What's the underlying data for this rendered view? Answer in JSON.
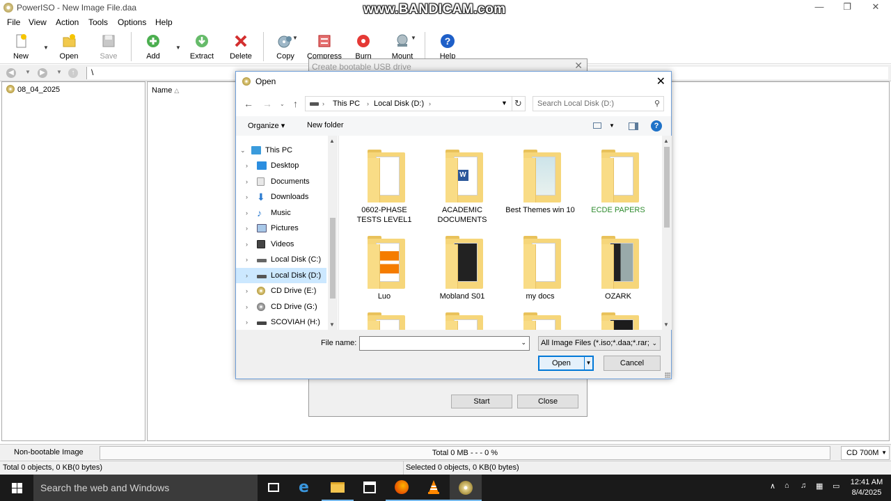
{
  "app": {
    "title": "PowerISO - New Image File.daa",
    "watermark": "www.BANDICAM.com",
    "window_buttons": {
      "minimize": "—",
      "maximize": "❐",
      "close": "✕"
    }
  },
  "menu": [
    "File",
    "View",
    "Action",
    "Tools",
    "Options",
    "Help"
  ],
  "toolbar": {
    "new": "New",
    "open": "Open",
    "save": "Save",
    "add": "Add",
    "extract": "Extract",
    "delete": "Delete",
    "copy": "Copy",
    "compress": "Compress",
    "burn": "Burn",
    "mount": "Mount",
    "help": "Help"
  },
  "address": {
    "path": "\\"
  },
  "tree": {
    "root": "08_04_2025"
  },
  "list": {
    "column_name": "Name"
  },
  "usb_dialog": {
    "title": "Create bootable USB drive",
    "start": "Start",
    "close": "Close"
  },
  "open_dialog": {
    "title": "Open",
    "breadcrumb": [
      "This PC",
      "Local Disk (D:)"
    ],
    "search_placeholder": "Search Local Disk (D:)",
    "organize": "Organize ▾",
    "new_folder": "New folder",
    "nav_items": [
      {
        "label": "This PC",
        "icon": "this-pc-icon"
      },
      {
        "label": "Desktop",
        "icon": "desktop-icon"
      },
      {
        "label": "Documents",
        "icon": "documents-icon"
      },
      {
        "label": "Downloads",
        "icon": "downloads-icon"
      },
      {
        "label": "Music",
        "icon": "music-icon"
      },
      {
        "label": "Pictures",
        "icon": "pictures-icon"
      },
      {
        "label": "Videos",
        "icon": "videos-icon"
      },
      {
        "label": "Local Disk (C:)",
        "icon": "drive-icon"
      },
      {
        "label": "Local Disk (D:)",
        "icon": "drive-icon",
        "selected": true
      },
      {
        "label": "CD Drive (E:)",
        "icon": "cd-drive-icon"
      },
      {
        "label": "CD Drive (G:)",
        "icon": "cd-drive-icon"
      },
      {
        "label": "SCOVIAH (H:)",
        "icon": "usb-drive-icon"
      }
    ],
    "files": [
      {
        "name": "0602-PHASE TESTS LEVEL1"
      },
      {
        "name": "ACADEMIC DOCUMENTS"
      },
      {
        "name": "Best Themes win 10"
      },
      {
        "name": "ECDE PAPERS",
        "color": "#2e8b2e"
      },
      {
        "name": "Luo"
      },
      {
        "name": "Mobland S01"
      },
      {
        "name": "my docs"
      },
      {
        "name": "OZARK"
      },
      {
        "name": ""
      },
      {
        "name": ""
      },
      {
        "name": ""
      },
      {
        "name": ""
      }
    ],
    "file_name_label": "File name:",
    "file_name_value": "",
    "file_type": "All Image Files (*.iso;*.daa;*.rar;",
    "open_button": "Open",
    "cancel_button": "Cancel"
  },
  "status": {
    "bootable": "Non-bootable Image",
    "progress_text": "Total  0 MB   - - -  0 %",
    "progress_percent": 0,
    "media": "CD 700M",
    "total": "Total 0 objects, 0 KB(0 bytes)",
    "selected": "Selected 0 objects, 0 KB(0 bytes)"
  },
  "taskbar": {
    "search_placeholder": "Search the web and Windows",
    "time": "12:41 AM",
    "date": "8/4/2025"
  },
  "colors": {
    "accent": "#0078d7",
    "selection": "#cce8ff",
    "folder": "#f6d67a",
    "taskbar": "#1a1a1a"
  }
}
